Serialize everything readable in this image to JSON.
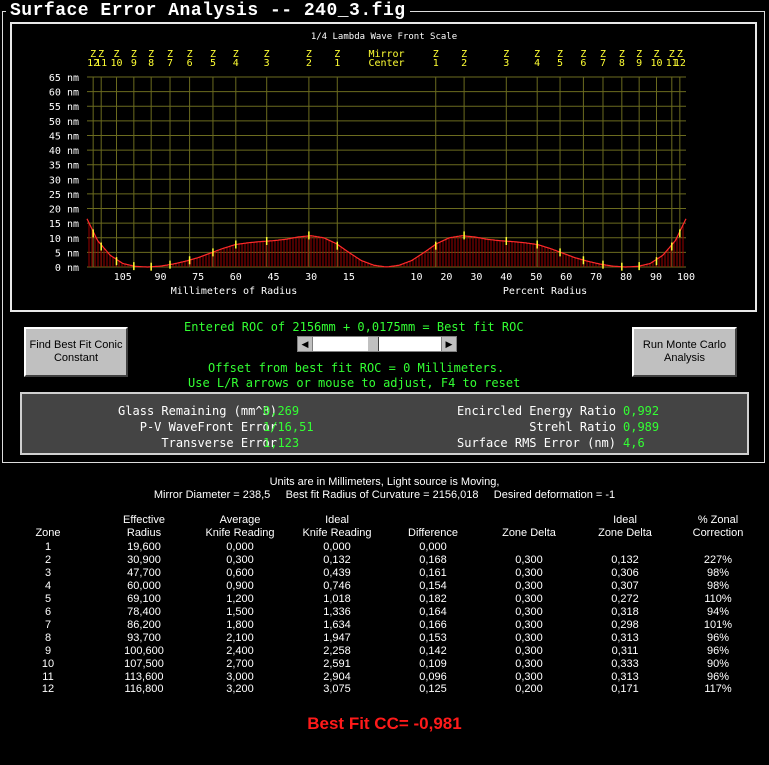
{
  "window": {
    "title": "Surface Error Analysis -- 240_3.fig"
  },
  "chart_data": {
    "type": "bar",
    "title": "1/4 Lambda Wave Front Scale",
    "ylabel": "",
    "ylim": [
      0,
      65
    ],
    "yticks": [
      "65 nm",
      "60 nm",
      "55 nm",
      "50 nm",
      "45 nm",
      "40 nm",
      "35 nm",
      "30 nm",
      "25 nm",
      "20 nm",
      "15 nm",
      "10 nm",
      "5 nm",
      "0 nm"
    ],
    "ytick_values": [
      65,
      60,
      55,
      50,
      45,
      40,
      35,
      30,
      25,
      20,
      15,
      10,
      5,
      0
    ],
    "left_xlabel": "Millimeters of Radius",
    "right_xlabel": "Percent Radius",
    "left_xticks": [
      "105",
      "90",
      "75",
      "60",
      "45",
      "30",
      "15"
    ],
    "left_xtick_values": [
      105,
      90,
      75,
      60,
      45,
      30,
      15
    ],
    "right_xticks": [
      "10",
      "20",
      "30",
      "40",
      "50",
      "60",
      "70",
      "80",
      "90",
      "100"
    ],
    "right_xtick_values": [
      10,
      20,
      30,
      40,
      50,
      60,
      70,
      80,
      90,
      100
    ],
    "mirror_center_label": [
      "Mirror",
      "Center"
    ],
    "zone_labels_left": [
      {
        "top": "Z",
        "bottom": "12",
        "r": 116.8
      },
      {
        "top": "Z",
        "bottom": "11",
        "r": 113.6
      },
      {
        "top": "Z",
        "bottom": "10",
        "r": 107.5
      },
      {
        "top": "Z",
        "bottom": "9",
        "r": 100.6
      },
      {
        "top": "Z",
        "bottom": "8",
        "r": 93.7
      },
      {
        "top": "Z",
        "bottom": "7",
        "r": 86.2
      },
      {
        "top": "Z",
        "bottom": "6",
        "r": 78.4
      },
      {
        "top": "Z",
        "bottom": "5",
        "r": 69.1
      },
      {
        "top": "Z",
        "bottom": "4",
        "r": 60.0
      },
      {
        "top": "Z",
        "bottom": "3",
        "r": 47.7
      },
      {
        "top": "Z",
        "bottom": "2",
        "r": 30.9
      },
      {
        "top": "Z",
        "bottom": "1",
        "r": 19.6
      }
    ],
    "zone_labels_right": [
      {
        "top": "Z",
        "bottom": "1",
        "r": 19.6
      },
      {
        "top": "Z",
        "bottom": "2",
        "r": 30.9
      },
      {
        "top": "Z",
        "bottom": "3",
        "r": 47.7
      },
      {
        "top": "Z",
        "bottom": "4",
        "r": 60.0
      },
      {
        "top": "Z",
        "bottom": "5",
        "r": 69.1
      },
      {
        "top": "Z",
        "bottom": "6",
        "r": 78.4
      },
      {
        "top": "Z",
        "bottom": "7",
        "r": 86.2
      },
      {
        "top": "Z",
        "bottom": "8",
        "r": 93.7
      },
      {
        "top": "Z",
        "bottom": "9",
        "r": 100.6
      },
      {
        "top": "Z",
        "bottom": "10",
        "r": 107.5
      },
      {
        "top": "Z",
        "bottom": "11",
        "r": 113.6
      },
      {
        "top": "Z",
        "bottom": "12",
        "r": 116.8
      }
    ],
    "radius_max": 119.25,
    "profile": [
      {
        "r": 0,
        "nm": 0
      },
      {
        "r": 5,
        "nm": 0.6
      },
      {
        "r": 10,
        "nm": 2.2
      },
      {
        "r": 15,
        "nm": 5.0
      },
      {
        "r": 20,
        "nm": 8.0
      },
      {
        "r": 25,
        "nm": 10.0
      },
      {
        "r": 30,
        "nm": 10.7
      },
      {
        "r": 35,
        "nm": 10.3
      },
      {
        "r": 40,
        "nm": 9.5
      },
      {
        "r": 45,
        "nm": 9.0
      },
      {
        "r": 50,
        "nm": 8.7
      },
      {
        "r": 55,
        "nm": 8.3
      },
      {
        "r": 60,
        "nm": 7.7
      },
      {
        "r": 65,
        "nm": 6.4
      },
      {
        "r": 70,
        "nm": 4.8
      },
      {
        "r": 75,
        "nm": 3.2
      },
      {
        "r": 80,
        "nm": 2.0
      },
      {
        "r": 85,
        "nm": 1.0
      },
      {
        "r": 90,
        "nm": 0.3
      },
      {
        "r": 95,
        "nm": 0.0
      },
      {
        "r": 100,
        "nm": 0.2
      },
      {
        "r": 105,
        "nm": 1.2
      },
      {
        "r": 110,
        "nm": 4.0
      },
      {
        "r": 115,
        "nm": 9.0
      },
      {
        "r": 119.25,
        "nm": 16.5
      }
    ],
    "zone_markers_nm": [
      {
        "r": 19.6,
        "nm": 7.3
      },
      {
        "r": 30.9,
        "nm": 10.8
      },
      {
        "r": 47.7,
        "nm": 8.9
      },
      {
        "r": 60.0,
        "nm": 7.7
      },
      {
        "r": 69.1,
        "nm": 5.0
      },
      {
        "r": 78.4,
        "nm": 2.3
      },
      {
        "r": 86.2,
        "nm": 0.8
      },
      {
        "r": 93.7,
        "nm": 0.1
      },
      {
        "r": 100.6,
        "nm": 0.3
      },
      {
        "r": 107.5,
        "nm": 2.0
      },
      {
        "r": 113.6,
        "nm": 7.0
      },
      {
        "r": 116.8,
        "nm": 11.5
      }
    ]
  },
  "roc": {
    "entered_line": "Entered ROC of 2156mm + 0,0175mm = Best fit ROC",
    "offset_line": "Offset from best fit ROC = 0 Millimeters.",
    "help_line": "Use L/R arrows or mouse to adjust, F4 to reset",
    "scroll_left": "◀",
    "scroll_right": "▶",
    "scroll_position": 0.45
  },
  "buttons": {
    "conic": "Find Best Fit Conic Constant",
    "monte": "Run Monte Carlo Analysis"
  },
  "stats": {
    "glass_label": "Glass Remaining (mm^3)",
    "glass_value": "0,269",
    "pv_label": "P-V WaveFront Error",
    "pv_value": "1/16,51",
    "transverse_label": "Transverse Error",
    "transverse_value": "1,123",
    "encircled_label": "Encircled Energy Ratio",
    "encircled_value": "0,992",
    "strehl_label": "Strehl Ratio",
    "strehl_value": "0,989",
    "rms_label": "Surface RMS Error (nm)",
    "rms_value": "4,6"
  },
  "info": {
    "line1": "Units are in Millimeters, Light source is Moving,",
    "line2": "Mirror Diameter = 238,5     Best fit Radius of Curvature = 2156,018     Desired deformation = -1"
  },
  "table": {
    "headers": [
      [
        "",
        "Zone"
      ],
      [
        "Effective",
        "Radius"
      ],
      [
        "Average",
        "Knife Reading"
      ],
      [
        "Ideal",
        "Knife Reading"
      ],
      [
        "",
        "Difference"
      ],
      [
        "",
        "Zone Delta"
      ],
      [
        "Ideal",
        "Zone Delta"
      ],
      [
        "% Zonal",
        "Correction"
      ]
    ],
    "rows": [
      [
        "1",
        "19,600",
        "0,000",
        "0,000",
        "0,000",
        "",
        "",
        ""
      ],
      [
        "2",
        "30,900",
        "0,300",
        "0,132",
        "0,168",
        "0,300",
        "0,132",
        "227%"
      ],
      [
        "3",
        "47,700",
        "0,600",
        "0,439",
        "0,161",
        "0,300",
        "0,306",
        "98%"
      ],
      [
        "4",
        "60,000",
        "0,900",
        "0,746",
        "0,154",
        "0,300",
        "0,307",
        "98%"
      ],
      [
        "5",
        "69,100",
        "1,200",
        "1,018",
        "0,182",
        "0,300",
        "0,272",
        "110%"
      ],
      [
        "6",
        "78,400",
        "1,500",
        "1,336",
        "0,164",
        "0,300",
        "0,318",
        "94%"
      ],
      [
        "7",
        "86,200",
        "1,800",
        "1,634",
        "0,166",
        "0,300",
        "0,298",
        "101%"
      ],
      [
        "8",
        "93,700",
        "2,100",
        "1,947",
        "0,153",
        "0,300",
        "0,313",
        "96%"
      ],
      [
        "9",
        "100,600",
        "2,400",
        "2,258",
        "0,142",
        "0,300",
        "0,311",
        "96%"
      ],
      [
        "10",
        "107,500",
        "2,700",
        "2,591",
        "0,109",
        "0,300",
        "0,333",
        "90%"
      ],
      [
        "11",
        "113,600",
        "3,000",
        "2,904",
        "0,096",
        "0,300",
        "0,313",
        "96%"
      ],
      [
        "12",
        "116,800",
        "3,200",
        "3,075",
        "0,125",
        "0,200",
        "0,171",
        "117%"
      ]
    ]
  },
  "best_fit": "Best Fit CC= -0,981"
}
